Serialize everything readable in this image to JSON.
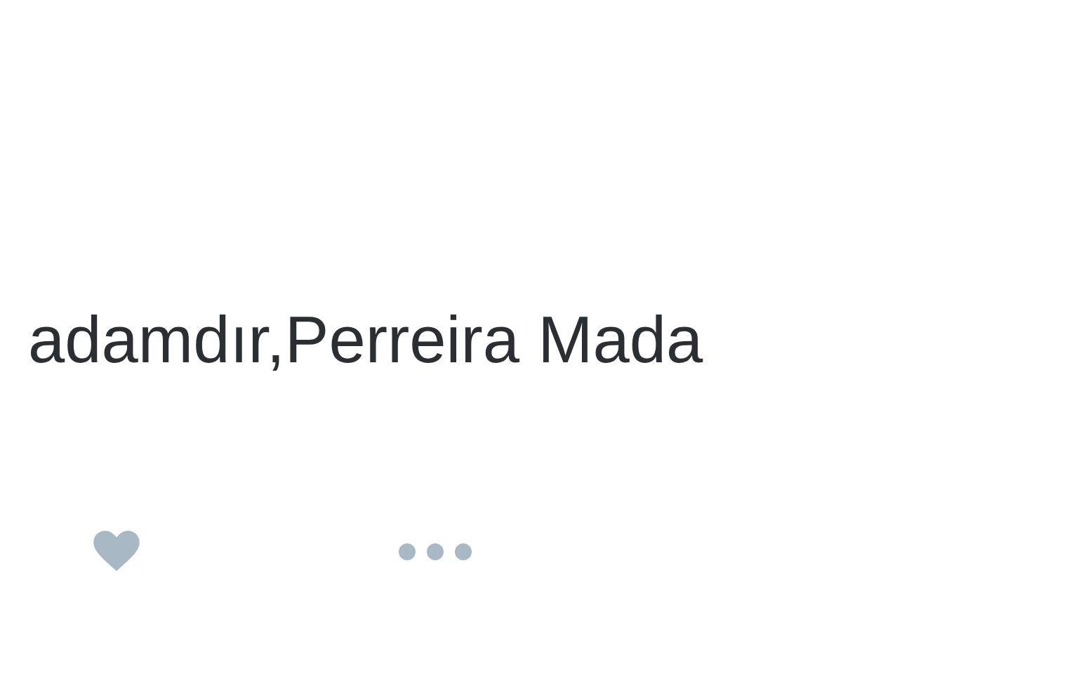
{
  "tweet": {
    "text": "adamdır,Perreira Mada"
  }
}
